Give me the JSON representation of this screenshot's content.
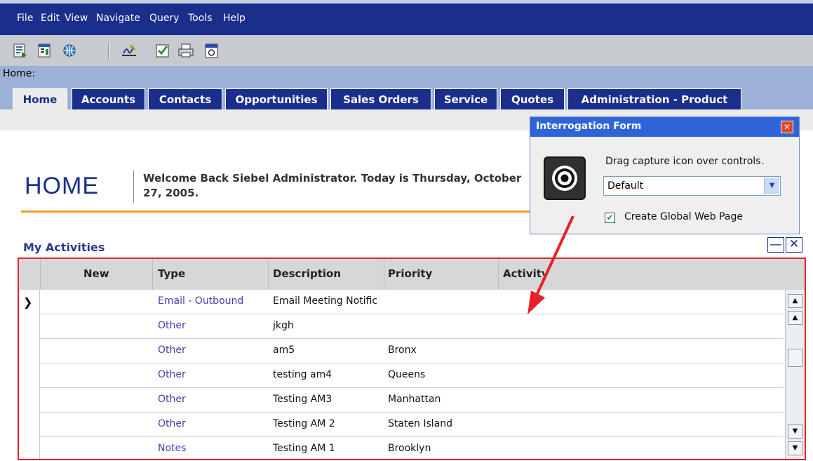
{
  "menubar": {
    "items": [
      "File",
      "Edit",
      "View",
      "Navigate",
      "Query",
      "Tools",
      "Help"
    ]
  },
  "toolbar": {
    "icons": [
      "new-record-icon",
      "new-form-icon",
      "globe-icon",
      "signature-icon",
      "checklist-icon",
      "print-icon",
      "calendar-icon"
    ]
  },
  "breadcrumb": {
    "label": "Home:"
  },
  "tabs": [
    {
      "label": "Home",
      "active": true
    },
    {
      "label": "Accounts"
    },
    {
      "label": "Contacts"
    },
    {
      "label": "Opportunities"
    },
    {
      "label": "Sales Orders"
    },
    {
      "label": "Service"
    },
    {
      "label": "Quotes"
    },
    {
      "label": "Administration - Product"
    }
  ],
  "header": {
    "title": "HOME",
    "welcome": "Welcome Back Siebel Administrator.  Today is Thursday, October 27, 2005."
  },
  "activities": {
    "title": "My Activities",
    "columns": [
      "New",
      "Type",
      "Description",
      "Priority",
      "Activity"
    ],
    "rows": [
      {
        "type": "Email - Outbound",
        "description": "Email Meeting Notific",
        "priority": ""
      },
      {
        "type": "Other",
        "description": "jkgh",
        "priority": ""
      },
      {
        "type": "Other",
        "description": "am5",
        "priority": "Bronx"
      },
      {
        "type": "Other",
        "description": "testing am4",
        "priority": "Queens"
      },
      {
        "type": "Other",
        "description": "Testing AM3",
        "priority": "Manhattan"
      },
      {
        "type": "Other",
        "description": "Testing AM 2",
        "priority": "Staten Island"
      },
      {
        "type": "Notes",
        "description": "Testing AM 1",
        "priority": "Brooklyn"
      }
    ]
  },
  "interrogation": {
    "title": "Interrogation Form",
    "hint": "Drag capture icon over controls.",
    "select_value": "Default",
    "checkbox_label": "Create Global Web Page",
    "checkbox_checked": true
  },
  "colors": {
    "menu_blue": "#1a2e8c",
    "accent_orange": "#f39a2b",
    "highlight_red": "#e8202a",
    "titlebar_blue": "#2f63d8"
  }
}
